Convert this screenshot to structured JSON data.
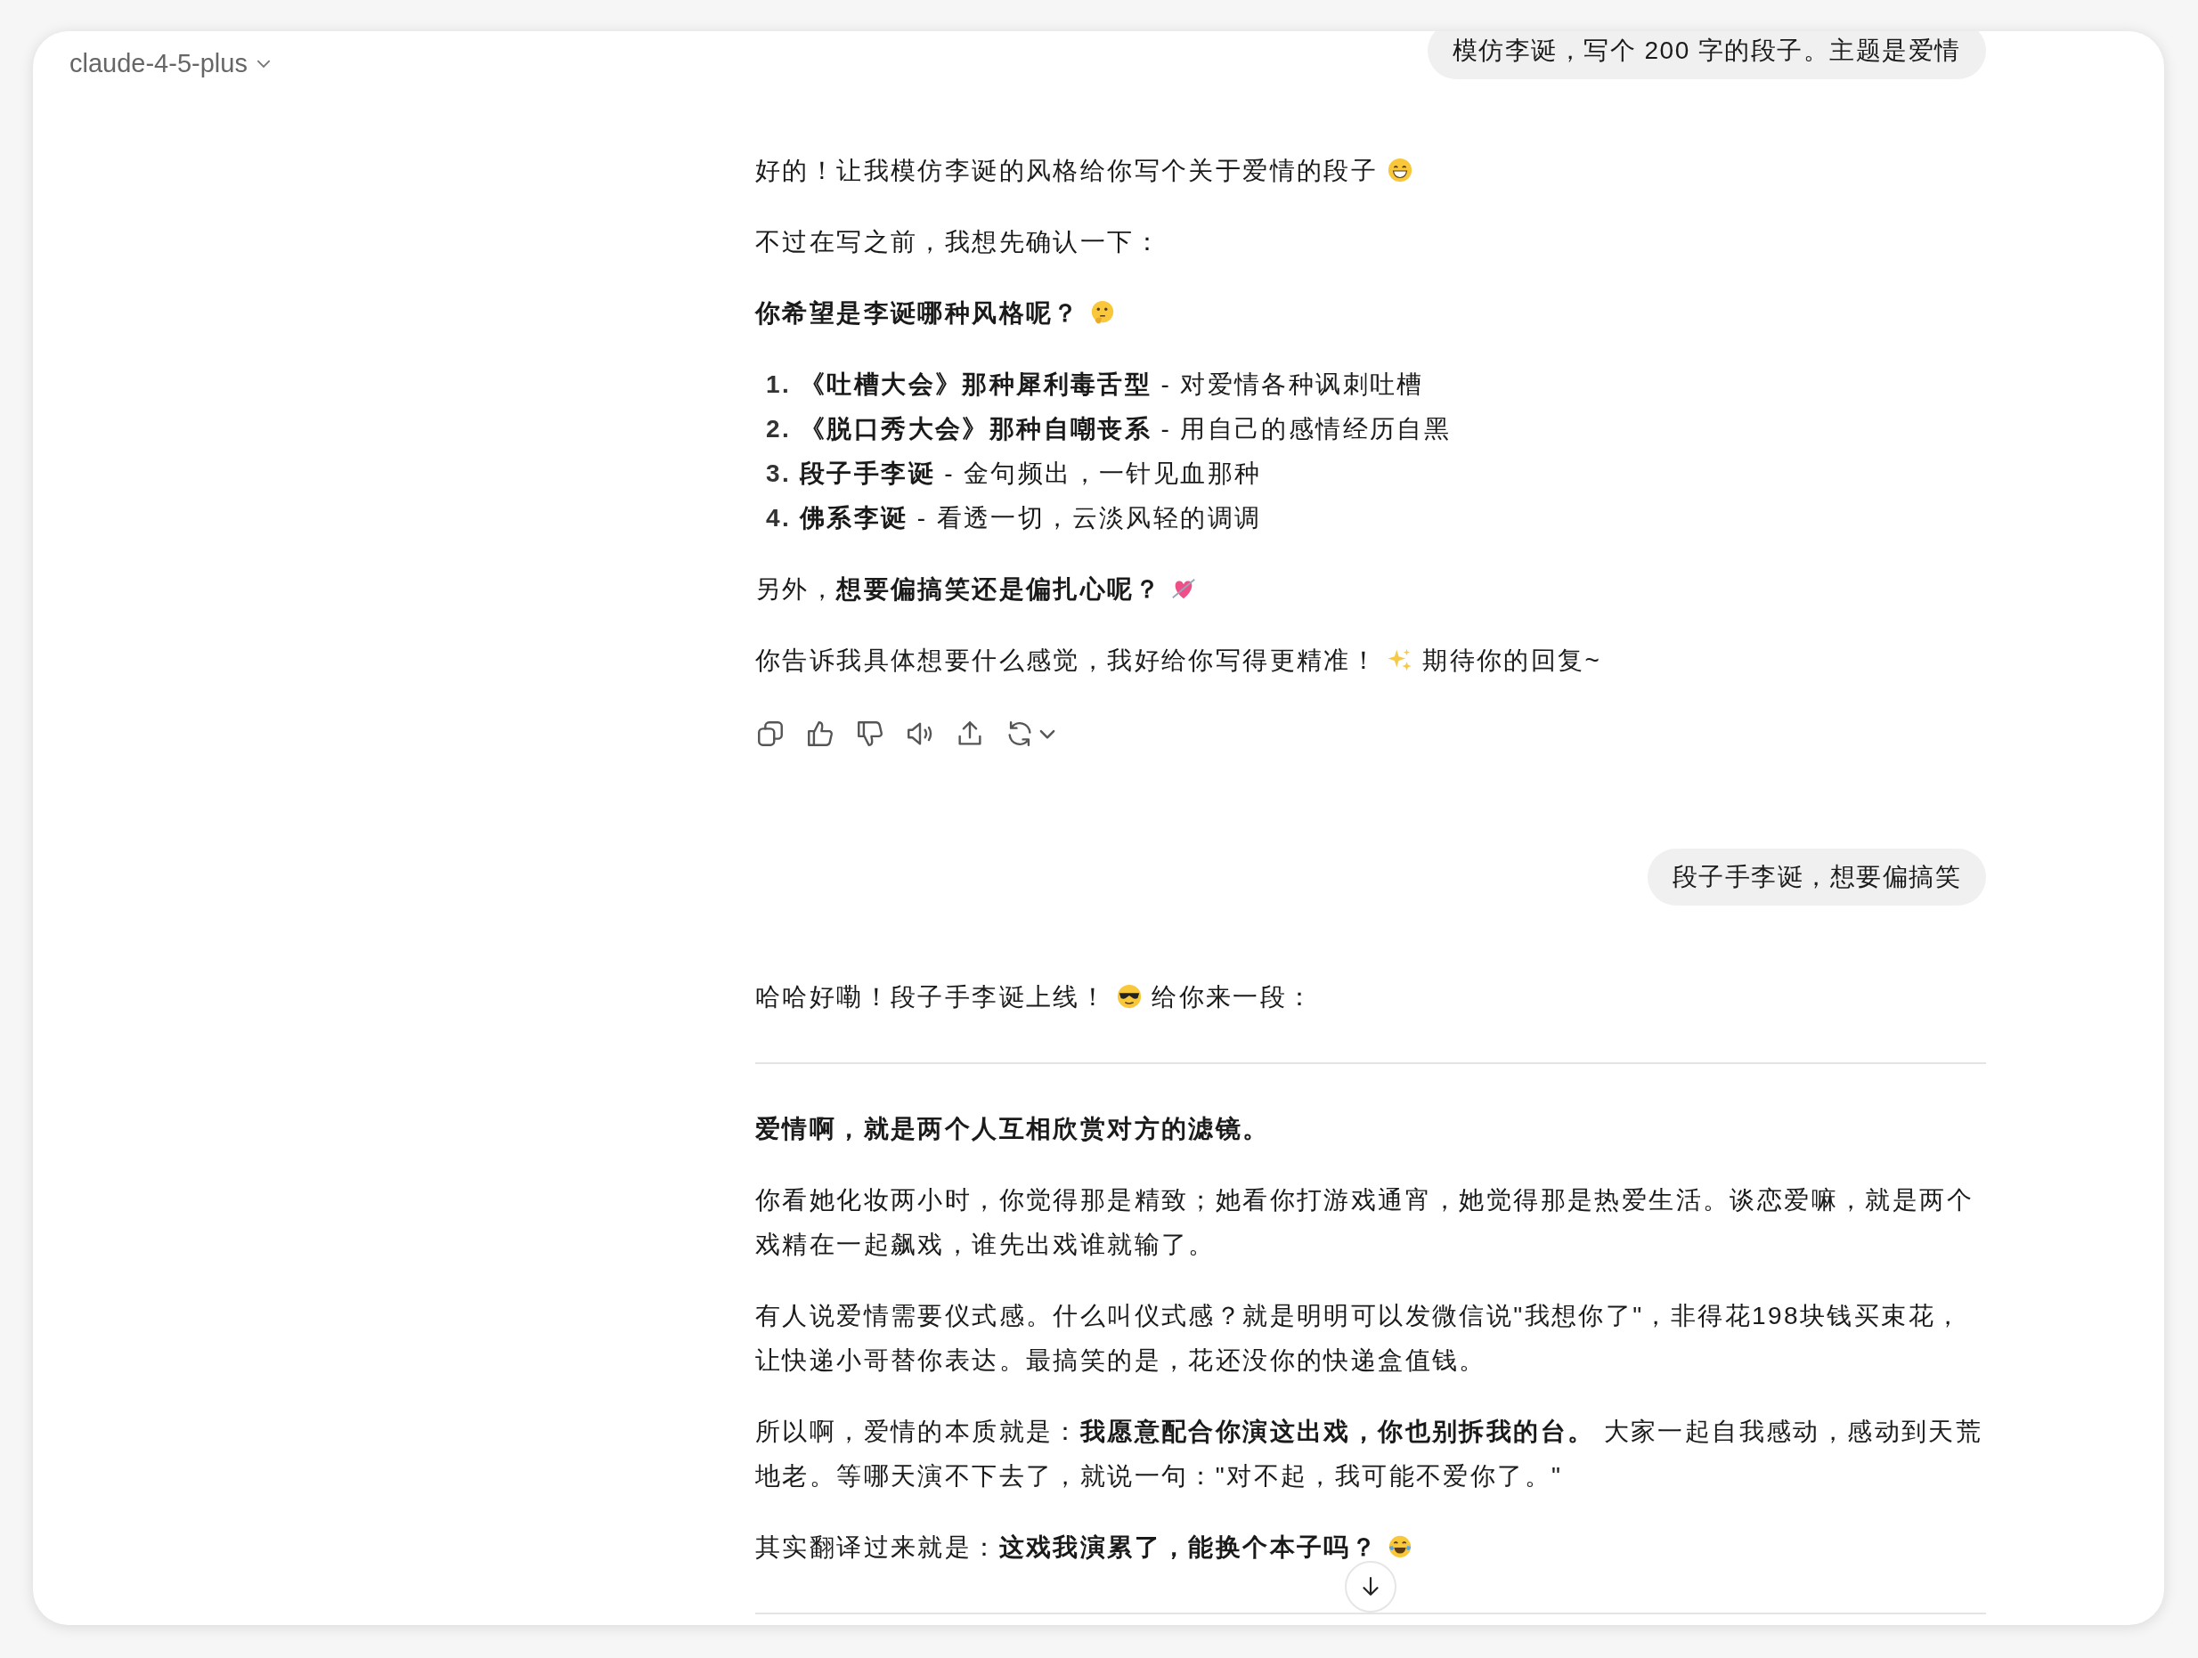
{
  "header": {
    "model": "claude-4-5-plus"
  },
  "messages": [
    {
      "kind": "user",
      "text": "模仿李诞，写个 200 字的段子。主题是爱情"
    },
    {
      "kind": "assistant",
      "blocks": [
        {
          "kind": "paragraph",
          "parts": [
            {
              "kind": "text",
              "text": "好的！让我模仿李诞的风格给你写个关于爱情的段子"
            },
            {
              "kind": "grin"
            }
          ]
        },
        {
          "kind": "paragraph",
          "parts": [
            {
              "kind": "text",
              "text": "不过在写之前，我想先确认一下："
            }
          ]
        },
        {
          "kind": "paragraph",
          "parts": [
            {
              "kind": "text",
              "text": "**你希望是李诞哪种风格呢？**"
            },
            {
              "kind": "thinking"
            }
          ]
        },
        {
          "kind": "list",
          "items": [
            {
              "number": "1.",
              "text": "**《吐槽大会》那种犀利毒舌型** - 对爱情各种讽刺吐槽"
            },
            {
              "number": "2.",
              "text": "**《脱口秀大会》那种自嘲丧系** - 用自己的感情经历自黑"
            },
            {
              "number": "3.",
              "text": "**段子手李诞** - 金句频出，一针见血那种"
            },
            {
              "number": "4.",
              "text": "**佛系李诞** - 看透一切，云淡风轻的调调"
            }
          ]
        },
        {
          "kind": "paragraph",
          "parts": [
            {
              "kind": "text",
              "text": "另外，**想要偏搞笑还是偏扎心呢？**"
            },
            {
              "kind": "heart"
            }
          ]
        },
        {
          "kind": "paragraph",
          "parts": [
            {
              "kind": "text",
              "text": "你告诉我具体想要什么感觉，我好给你写得更精准！"
            },
            {
              "kind": "sparkles"
            },
            {
              "kind": "text",
              "text": "期待你的回复~"
            }
          ]
        }
      ],
      "actions": [
        {
          "kind": "copy"
        },
        {
          "kind": "like"
        },
        {
          "kind": "dislike"
        },
        {
          "kind": "speak"
        },
        {
          "kind": "share"
        },
        {
          "kind": "regenerate"
        }
      ]
    },
    {
      "kind": "user",
      "text": "段子手李诞，想要偏搞笑"
    },
    {
      "kind": "assistant",
      "blocks": [
        {
          "kind": "paragraph",
          "parts": [
            {
              "kind": "text",
              "text": "哈哈好嘞！段子手李诞上线！"
            },
            {
              "kind": "sunglasses"
            },
            {
              "kind": "text",
              "text": "给你来一段："
            }
          ]
        },
        {
          "kind": "divider"
        },
        {
          "kind": "paragraph",
          "parts": [
            {
              "kind": "text",
              "text": "**爱情啊，就是两个人互相欣赏对方的滤镜。**"
            }
          ]
        },
        {
          "kind": "paragraph",
          "parts": [
            {
              "kind": "text",
              "text": "你看她化妆两小时，你觉得那是精致；她看你打游戏通宵，她觉得那是热爱生活。谈恋爱嘛，就是两个戏精在一起飙戏，谁先出戏谁就输了。"
            }
          ]
        },
        {
          "kind": "paragraph",
          "parts": [
            {
              "kind": "text",
              "text": "有人说爱情需要仪式感。什么叫仪式感？就是明明可以发微信说\"我想你了\"，非得花198块钱买束花，让快递小哥替你表达。最搞笑的是，花还没你的快递盒值钱。"
            }
          ]
        },
        {
          "kind": "paragraph",
          "parts": [
            {
              "kind": "text",
              "text": "所以啊，爱情的本质就是：**我愿意配合你演这出戏，你也别拆我的台。** 大家一起自我感动，感动到天荒地老。等哪天演不下去了，就说一句：\"对不起，我可能不爱你了。\""
            }
          ]
        },
        {
          "kind": "paragraph",
          "parts": [
            {
              "kind": "text",
              "text": "其实翻译过来就是：**这戏我演累了，能换个本子吗？**"
            },
            {
              "kind": "laughing"
            }
          ]
        },
        {
          "kind": "divider"
        }
      ]
    }
  ]
}
